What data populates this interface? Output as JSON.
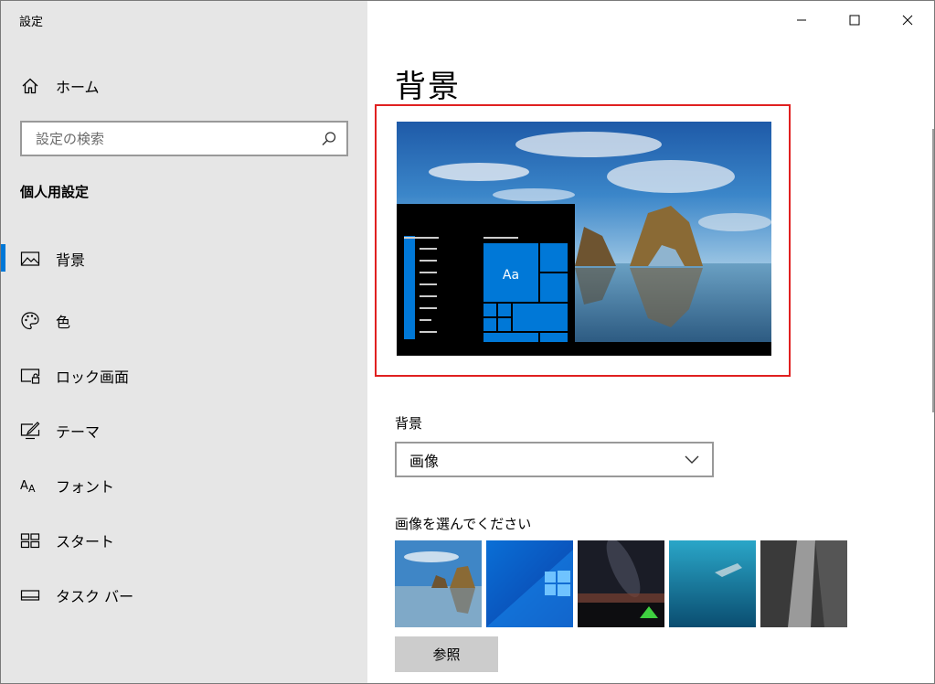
{
  "window": {
    "title": "設定"
  },
  "controls": {
    "minimize": "minimize",
    "maximize": "maximize",
    "close": "close"
  },
  "sidebar": {
    "home_label": "ホーム",
    "search_placeholder": "設定の検索",
    "section_title": "個人用設定",
    "items": [
      {
        "label": "背景",
        "icon": "picture-icon",
        "active": true
      },
      {
        "label": "色",
        "icon": "palette-icon",
        "active": false
      },
      {
        "label": "ロック画面",
        "icon": "lock-screen-icon",
        "active": false
      },
      {
        "label": "テーマ",
        "icon": "theme-icon",
        "active": false
      },
      {
        "label": "フォント",
        "icon": "font-icon",
        "active": false
      },
      {
        "label": "スタート",
        "icon": "start-icon",
        "active": false
      },
      {
        "label": "タスク バー",
        "icon": "taskbar-icon",
        "active": false
      }
    ]
  },
  "main": {
    "title": "背景",
    "preview_tile_text": "Aa",
    "background_label": "背景",
    "background_value": "画像",
    "choose_label": "画像を選んでください",
    "browse_label": "参照"
  },
  "colors": {
    "accent": "#0078d7",
    "highlight_border": "#e02020"
  }
}
